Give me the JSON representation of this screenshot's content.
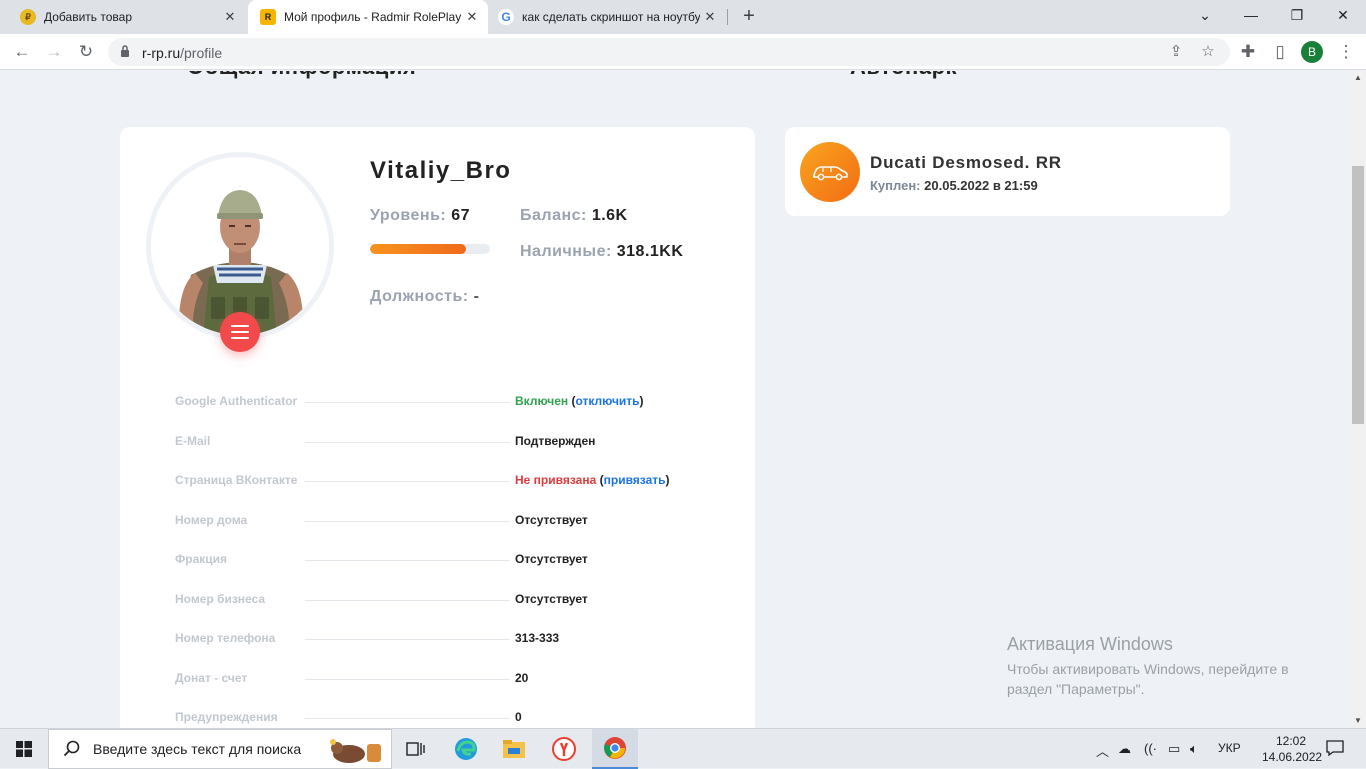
{
  "browser": {
    "tabs": [
      {
        "title": "Добавить товар"
      },
      {
        "title": "Мой профиль - Radmir RolePlay"
      },
      {
        "title": "как сделать скриншот на ноутбу"
      }
    ],
    "url_host": "r-rp.ru",
    "url_path": "/profile",
    "profile_initial": "B"
  },
  "page": {
    "sections": {
      "left_title": "Общая информация",
      "right_title": "Автопарк"
    },
    "profile": {
      "nickname": "Vitaliy_Bro",
      "level_label": "Уровень:",
      "level_value": "67",
      "level_progress": 0.8,
      "balance_label": "Баланс:",
      "balance_value": "1.6K",
      "cash_label": "Наличные:",
      "cash_value": "318.1KK",
      "position_label": "Должность:",
      "position_value": "-"
    },
    "info": {
      "ga_label": "Google Authenticator",
      "ga_value": "Включен",
      "ga_action": "отключить",
      "email_label": "E-Mail",
      "email_value": "Подтвержден",
      "vk_label": "Страница ВКонтакте",
      "vk_value": "Не привязана",
      "vk_action": "привязать",
      "house_label": "Номер дома",
      "house_value": "Отсутствует",
      "faction_label": "Фракция",
      "faction_value": "Отсутствует",
      "business_label": "Номер бизнеса",
      "business_value": "Отсутствует",
      "phone_label": "Номер телефона",
      "phone_value": "313-333",
      "donate_label": "Донат - счет",
      "donate_value": "20",
      "warnings_label": "Предупреждения",
      "warnings_value": "0"
    },
    "garage": {
      "car_name": "Ducati Desmosed. RR",
      "bought_label": "Куплен:",
      "bought_value": "20.05.2022 в 21:59"
    }
  },
  "watermark": {
    "title": "Активация Windows",
    "line1": "Чтобы активировать Windows, перейдите в",
    "line2": "раздел \"Параметры\"."
  },
  "taskbar": {
    "search_placeholder": "Введите здесь текст для поиска",
    "lang": "УКР",
    "time": "12:02",
    "date": "14.06.2022"
  },
  "colors": {
    "accent_orange": "#f26c13",
    "menu_red": "#f24a4a",
    "ok_green": "#2ea44f",
    "error_red": "#e03a3a",
    "link_blue": "#1a73e8"
  }
}
